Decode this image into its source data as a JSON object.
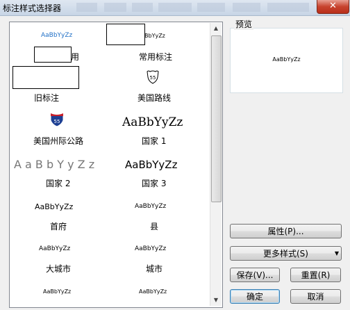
{
  "window": {
    "title": "标注样式选择器",
    "close_label": "✕"
  },
  "styles": [
    {
      "sample": "AaBbYyZz",
      "caption": ""
    },
    {
      "sample": "BbYyZz",
      "caption": ""
    },
    {
      "sample": "",
      "caption": "用"
    },
    {
      "sample": "",
      "caption": "常用标注"
    },
    {
      "sample": "",
      "caption": "旧标注"
    },
    {
      "sample": "55",
      "caption": "美国路线"
    },
    {
      "sample": "55",
      "caption": "美国州际公路"
    },
    {
      "sample": "AaBbYyZz",
      "caption": "国家 1"
    },
    {
      "sample": "A a B b Y y Z z",
      "caption": "国家 2"
    },
    {
      "sample": "AaBbYyZz",
      "caption": "国家 3"
    },
    {
      "sample": "AaBbYyZz",
      "caption": "首府"
    },
    {
      "sample": "AaBbYyZz",
      "caption": "县"
    },
    {
      "sample": "AaBbYyZz",
      "caption": "大城市"
    },
    {
      "sample": "AaBbYyZz",
      "caption": "城市"
    },
    {
      "sample": "AaBbYyZz",
      "caption": ""
    },
    {
      "sample": "AaBbYyZz",
      "caption": ""
    }
  ],
  "preview": {
    "label": "预览",
    "sample": "AaBbYyZz"
  },
  "buttons": {
    "properties": "属性(P)...",
    "more_styles": "更多样式(S)",
    "save": "保存(V)...",
    "reset": "重置(R)",
    "ok": "确定",
    "cancel": "取消"
  },
  "colors": {
    "accent_sample": "#1f6fc6",
    "shield_blue": "#1d3f93",
    "shield_red": "#c8202a"
  }
}
